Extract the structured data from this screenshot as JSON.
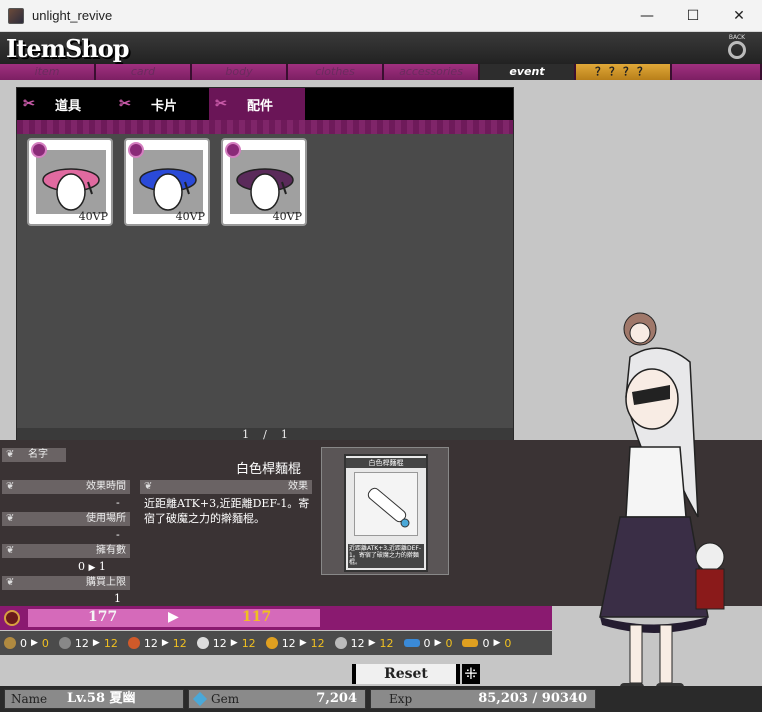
{
  "window": {
    "title": "unlight_revive",
    "minimize": "—",
    "maximize": "☐",
    "close": "✕"
  },
  "header": {
    "logo": "ItemShop",
    "back_label": "BACK"
  },
  "category_tabs": [
    {
      "label": "item",
      "active": false
    },
    {
      "label": "card",
      "active": false
    },
    {
      "label": "body",
      "active": false
    },
    {
      "label": "clothes",
      "active": false
    },
    {
      "label": "accessories",
      "active": false
    },
    {
      "label": "event",
      "active": true
    },
    {
      "label": "？？？？",
      "active": false
    }
  ],
  "sub_tabs": [
    {
      "label": "道具",
      "active": false
    },
    {
      "label": "卡片",
      "active": false
    },
    {
      "label": "配件",
      "active": true
    }
  ],
  "items": [
    {
      "price": "40VP",
      "color": "#e06aa0",
      "icon": "pink-beret-icon"
    },
    {
      "price": "40VP",
      "color": "#2a4ad8",
      "icon": "blue-beret-icon"
    },
    {
      "price": "40VP",
      "color": "#5a2a5a",
      "icon": "purple-beret-icon"
    }
  ],
  "pager": {
    "current": "1",
    "sep": "/",
    "total": "1"
  },
  "detail": {
    "name_label": "名字",
    "name_value": "白色桿麵棍",
    "effect_time_label": "效果時間",
    "effect_time_value": "-",
    "use_place_label": "使用場所",
    "use_place_value": "-",
    "owned_label": "擁有數",
    "owned_from": "0",
    "owned_to": "1",
    "limit_label": "購買上限",
    "limit_value": "1",
    "effect_label": "效果",
    "effect_text": "近距離ATK+3,近距離DEF-1。寄宿了破魔之力的擀麵棍。",
    "preview_title": "白色桿麵棍",
    "preview_text": "近距離ATK+3,近距離DEF-1。寄宿了破魔之力的擀麵棍。"
  },
  "vp": {
    "from": "177",
    "to": "117",
    "from_color": "#f5f5f5",
    "to_color": "#f0c020"
  },
  "gems": [
    {
      "icon": "gold-coin-icon",
      "a": "0",
      "b": "0",
      "color": "#b08a40"
    },
    {
      "icon": "gray-gem-icon",
      "a": "12",
      "b": "12",
      "color": "#888888"
    },
    {
      "icon": "orange-gem-icon",
      "a": "12",
      "b": "12",
      "color": "#d05a2a"
    },
    {
      "icon": "white-gem-icon",
      "a": "12",
      "b": "12",
      "color": "#dddddd"
    },
    {
      "icon": "yellow-gem-icon",
      "a": "12",
      "b": "12",
      "color": "#e0a020"
    },
    {
      "icon": "sparkle-gem-icon",
      "a": "12",
      "b": "12",
      "color": "#bbbbbb"
    },
    {
      "icon": "blue-fish-icon",
      "a": "0",
      "b": "0",
      "color": "#3a8ad8"
    },
    {
      "icon": "gold-fish-icon",
      "a": "0",
      "b": "0",
      "color": "#e0a020"
    }
  ],
  "reset_label": "Reset",
  "status": {
    "name_label": "Name",
    "name_value": "Lv.58 夏幽",
    "gem_label": "Gem",
    "gem_value": "7,204",
    "exp_label": "Exp",
    "exp_value": "85,203 / 90340"
  },
  "colors": {
    "accent": "#8a1a70",
    "tab": "#a0307f",
    "gold": "#e0a838"
  }
}
